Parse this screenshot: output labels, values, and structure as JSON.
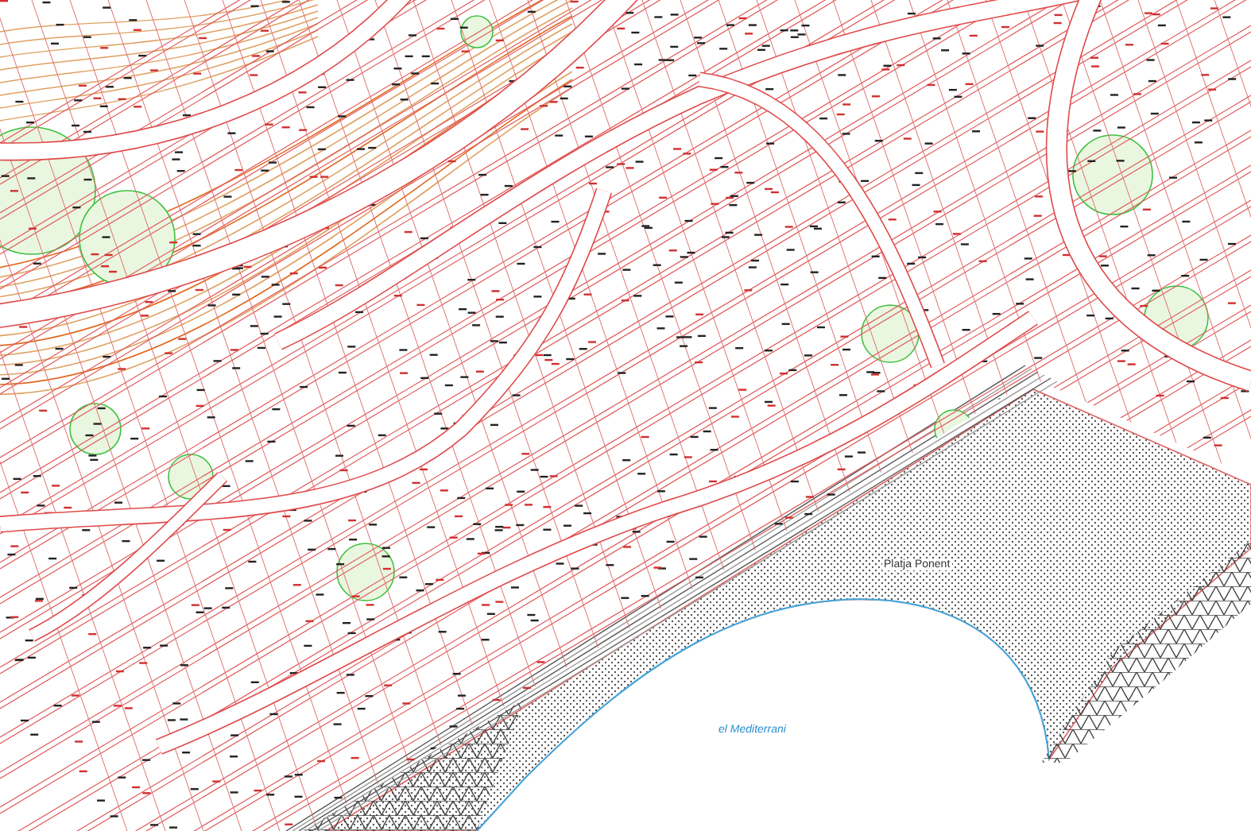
{
  "map": {
    "labels": [
      {
        "kind": "beach",
        "text": "Platja Ponent"
      },
      {
        "kind": "water",
        "text": "el Mediterrani"
      }
    ]
  }
}
